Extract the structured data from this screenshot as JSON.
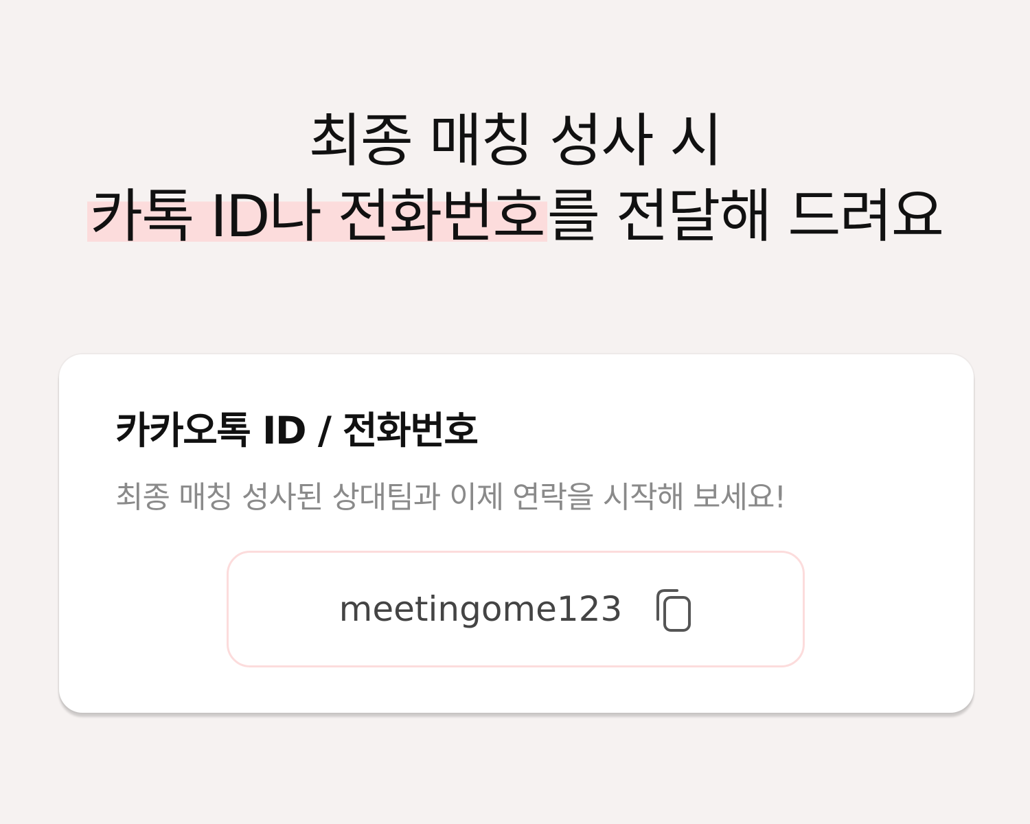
{
  "headline": {
    "line1": "최종 매칭 성사 시",
    "line2_highlight": "카톡 ID나 전화번호",
    "line2_rest": "를 전달해 드려요"
  },
  "card": {
    "title": "카카오톡 ID / 전화번호",
    "description": "최종 매칭 성사된 상대팀과 이제 연락을 시작해 보세요!",
    "contact_value": "meetingome123",
    "copy_icon": "copy-icon"
  },
  "colors": {
    "background": "#f6f2f1",
    "highlight": "#fcdcdc",
    "card": "#ffffff",
    "box_border": "#fcdcdc",
    "description": "#8a8a8a"
  }
}
